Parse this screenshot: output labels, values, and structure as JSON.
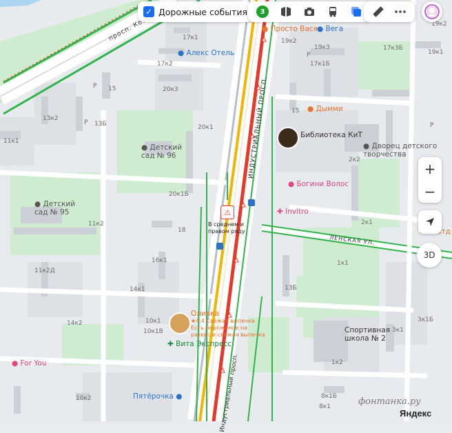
{
  "toolbar": {
    "traffic_label": "Дорожные события",
    "traffic_count": "3",
    "tools": [
      "panorama-icon",
      "camera-icon",
      "bus-icon",
      "layers-icon"
    ],
    "tools2": [
      "ruler-icon",
      "more-icon"
    ]
  },
  "controls": {
    "zoom_in": "+",
    "zoom_out": "−",
    "mode_3d": "3D"
  },
  "streets": {
    "industrial": "ИНДУСТРИАЛЬНЫЙ ПРОСП.",
    "industrial_lower": "Индустриальный просп.",
    "lenskaya": "ЛЕНСКАЯ УЛ.",
    "kos": "просп. Кос"
  },
  "buildings": [
    "17к1",
    "17к2",
    "20к3",
    "20к1",
    "20к1Б",
    "15",
    "13к2",
    "13Б",
    "11к1",
    "11к2",
    "11к2Д",
    "16к1",
    "14к1",
    "14к2",
    "10к1В",
    "10к1",
    "10к2",
    "18",
    "19к2",
    "17к1Б",
    "17к3Б",
    "19к3",
    "19к1",
    "15",
    "2к2",
    "2к1",
    "1к1",
    "13Б",
    "3к1Б",
    "3к1",
    "1к2",
    "8к1Б",
    "8к1",
    "19к2",
    "Р",
    "Р",
    "Р",
    "Р"
  ],
  "pois": {
    "alex_hotel": "Алекс Отель",
    "prosto_vasya": "Просто Вася",
    "vega": "Вега",
    "dymmi": "Дымми",
    "library": "Библиотека КиТ",
    "palace": "Дворец детского творчества",
    "bogini": "Богини Волос",
    "invitro": "Invitro",
    "kindergarten96": "Детский сад № 96",
    "kindergarten95": "Детский сад № 95",
    "sport_school": "Спортивная школа № 2",
    "olivka": "Оливка",
    "olivka_rating": "4.4",
    "olivka_desc": "Свежая выпечка Есть мороженое на развес и свежая выпечка",
    "vita": "Вита Экспресс",
    "pyaterochka": "Пятёрочка",
    "for_you": "For You",
    "otd": "отд"
  },
  "incident": {
    "text": "В среднем и правом ряду"
  },
  "footer": {
    "watermark": "фонтанка.ру",
    "brand": "Яндекс"
  },
  "colors": {
    "block": "#dfe3e8",
    "park": "#cdeccf",
    "road": "#ffffff",
    "traffic_red": "#e53a2a",
    "traffic_yellow": "#f3b400",
    "traffic_green": "#2fb34a",
    "accent": "#1a6cf0",
    "poi_orange": "#e6722b",
    "poi_pink": "#e0457b",
    "poi_green": "#168c3c",
    "poi_blue": "#2c73c8"
  }
}
